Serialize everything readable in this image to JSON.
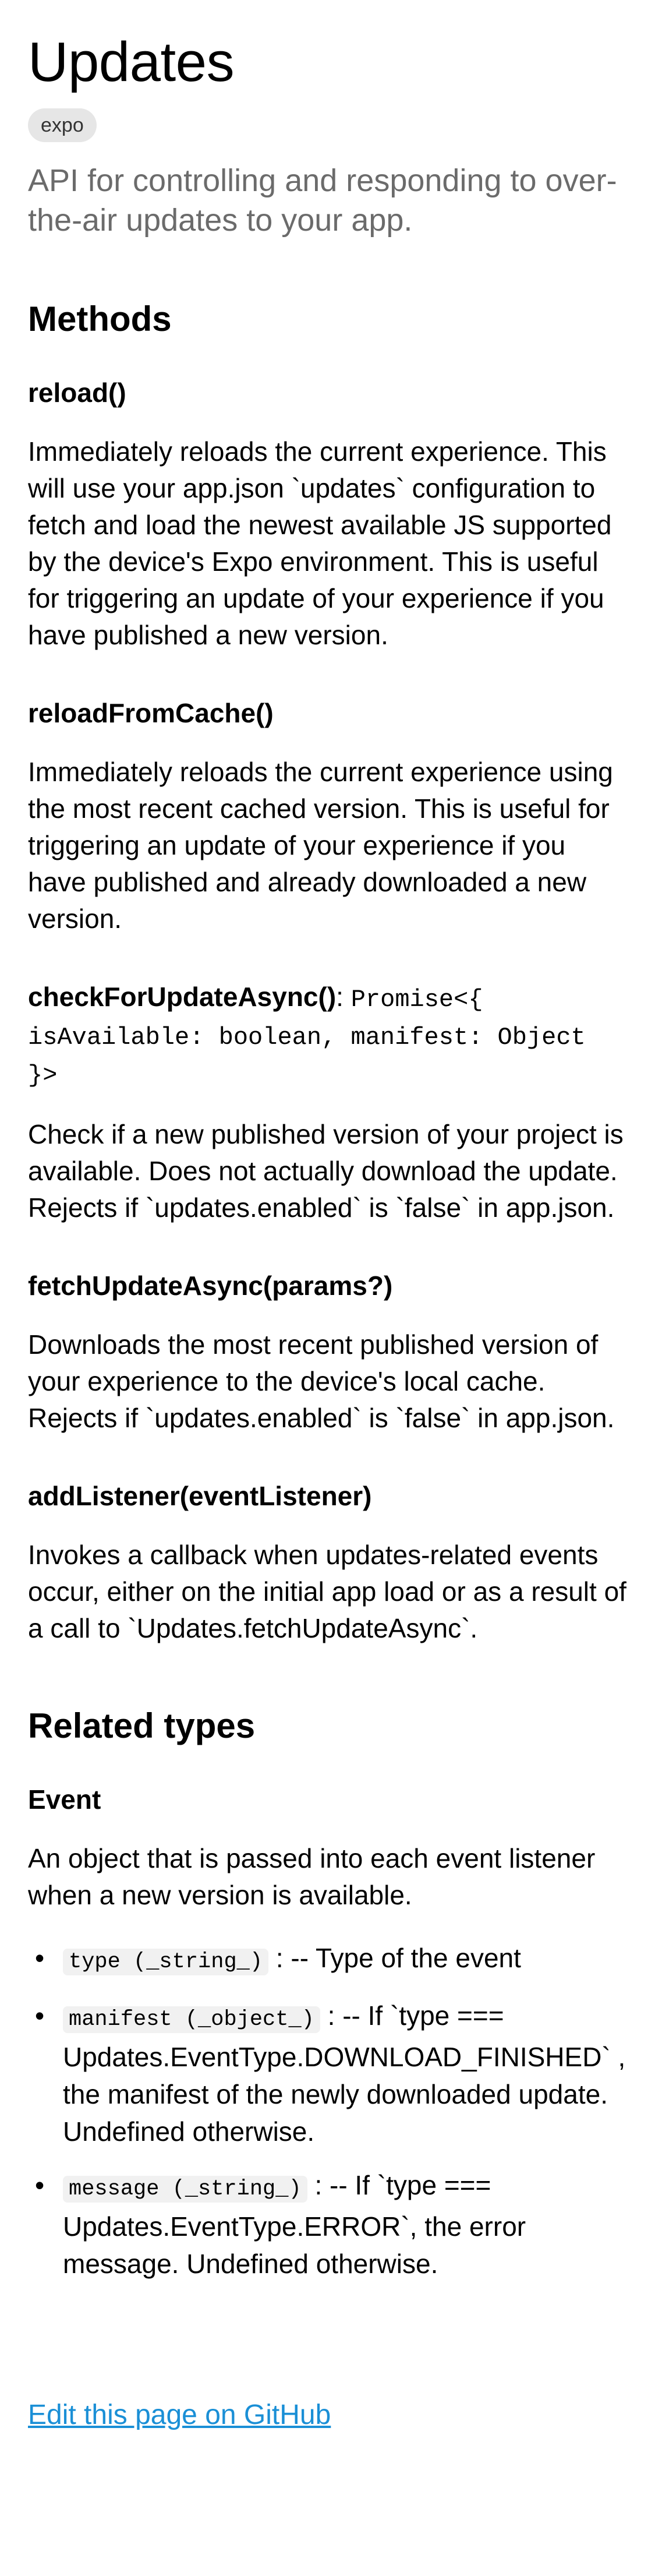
{
  "header": {
    "title": "Updates",
    "badge": "expo",
    "subtitle": "API for controlling and responding to over-the-air updates to your app."
  },
  "methods": {
    "heading": "Methods",
    "items": [
      {
        "name": "reload()",
        "description": "Immediately reloads the current experience. This will use your app.json `updates` configuration to fetch and load the newest available JS supported by the device's Expo environment. This is useful for triggering an update of your experience if you have published a new version."
      },
      {
        "name": "reloadFromCache()",
        "description": "Immediately reloads the current experience using the most recent cached version. This is useful for triggering an update of your experience if you have published and already downloaded a new version."
      },
      {
        "name": "checkForUpdateAsync()",
        "colon": ":",
        "signature": "Promise<{ isAvailable: boolean, manifest: Object }>",
        "description": "Check if a new published version of your project is available. Does not actually download the update. Rejects if `updates.enabled` is `false` in app.json."
      },
      {
        "name": "fetchUpdateAsync(params?)",
        "description": "Downloads the most recent published version of your experience to the device's local cache. Rejects if `updates.enabled` is `false` in app.json."
      },
      {
        "name": "addListener(eventListener)",
        "description": "Invokes a callback when updates-related events occur, either on the initial app load or as a result of a call to `Updates.fetchUpdateAsync`."
      }
    ]
  },
  "related_types": {
    "heading": "Related types",
    "event": {
      "name": "Event",
      "description": "An object that is passed into each event listener when a new version is available.",
      "properties": [
        {
          "code": "type (_string_)",
          "text": ": -- Type of the event"
        },
        {
          "code": "manifest (_object_)",
          "text": ": -- If `type === Updates.EventType.DOWNLOAD_FINISHED` , the manifest of the newly downloaded update. Undefined otherwise."
        },
        {
          "code": "message (_string_)",
          "text": ": -- If `type === Updates.EventType.ERROR`, the error message. Undefined otherwise."
        }
      ]
    }
  },
  "footer": {
    "edit_link": "Edit this page on GitHub"
  },
  "colors": {
    "link": "#1a8fd6",
    "subtitle": "#6b6b6b",
    "badge_bg": "#e6e6e6"
  }
}
